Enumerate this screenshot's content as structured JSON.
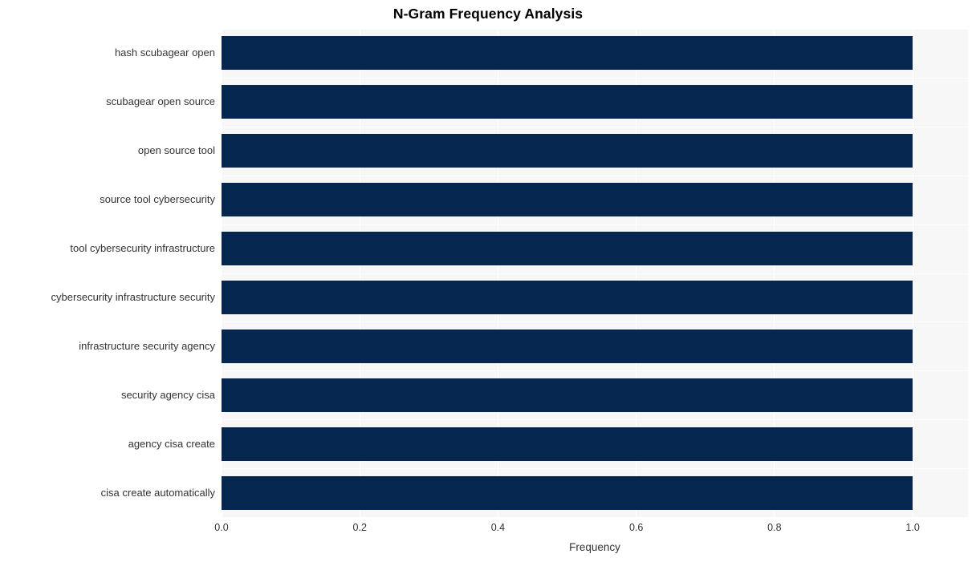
{
  "chart_data": {
    "type": "bar",
    "orientation": "horizontal",
    "title": "N-Gram Frequency Analysis",
    "xlabel": "Frequency",
    "ylabel": "",
    "categories": [
      "hash scubagear open",
      "scubagear open source",
      "open source tool",
      "source tool cybersecurity",
      "tool cybersecurity infrastructure",
      "cybersecurity infrastructure security",
      "infrastructure security agency",
      "security agency cisa",
      "agency cisa create",
      "cisa create automatically"
    ],
    "values": [
      1.0,
      1.0,
      1.0,
      1.0,
      1.0,
      1.0,
      1.0,
      1.0,
      1.0,
      1.0
    ],
    "xlim": [
      0.0,
      1.08
    ],
    "xticks": [
      "0.0",
      "0.2",
      "0.4",
      "0.6",
      "0.8",
      "1.0"
    ],
    "xtick_values": [
      0.0,
      0.2,
      0.4,
      0.6,
      0.8,
      1.0
    ],
    "grid": true,
    "legend": false,
    "bar_color": "#04264f",
    "plot_background": "#f7f7f7",
    "gridline_color": "#ffffff",
    "text_color": "#333333",
    "title_color": "#000000"
  }
}
